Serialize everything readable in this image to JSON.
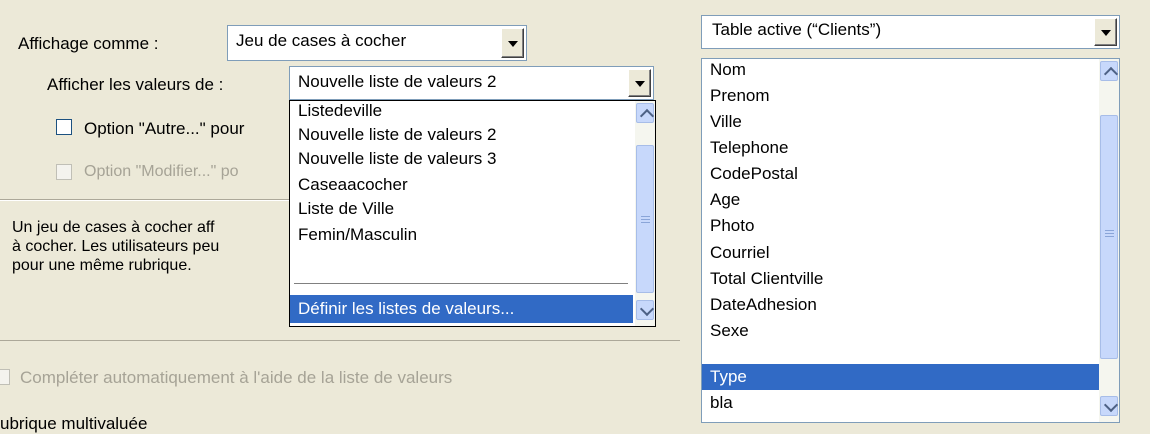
{
  "left_panel": {
    "display_as_label": "Affichage comme :",
    "display_as_value": "Jeu de cases à cocher",
    "show_values_label": "Afficher les valeurs de :",
    "show_values_value": "Nouvelle liste de valeurs 2",
    "option_other_label": "Option \"Autre...\" pour",
    "option_edit_label": "Option \"Modifier...\" po",
    "description": [
      "Un jeu de cases à cocher aff",
      "à cocher. Les utilisateurs peu",
      "pour une même rubrique."
    ],
    "autocomplete_label": "Compléter automatiquement à l'aide de la liste de valeurs",
    "multivalued_label": "ubrique multivaluée"
  },
  "value_list_dropdown": {
    "items": [
      "Listedeville",
      "Nouvelle liste de valeurs 2",
      "Nouvelle liste de valeurs 3",
      "Caseaacocher",
      "Liste de Ville",
      "Femin/Masculin"
    ],
    "define_item": "Définir les listes de valeurs..."
  },
  "right_panel": {
    "table_select_value": "Table active (“Clients”)",
    "fields": [
      "Nom",
      "Prenom",
      "Ville",
      "Telephone",
      "CodePostal",
      "Age",
      "Photo",
      "Courriel",
      "Total Clientville",
      "DateAdhesion",
      "Sexe",
      "Type",
      "bla"
    ],
    "selected_field": "Type"
  },
  "colors": {
    "selection": "#316ac5",
    "dialog_bg": "#ece9d8",
    "border": "#7f9db9"
  }
}
